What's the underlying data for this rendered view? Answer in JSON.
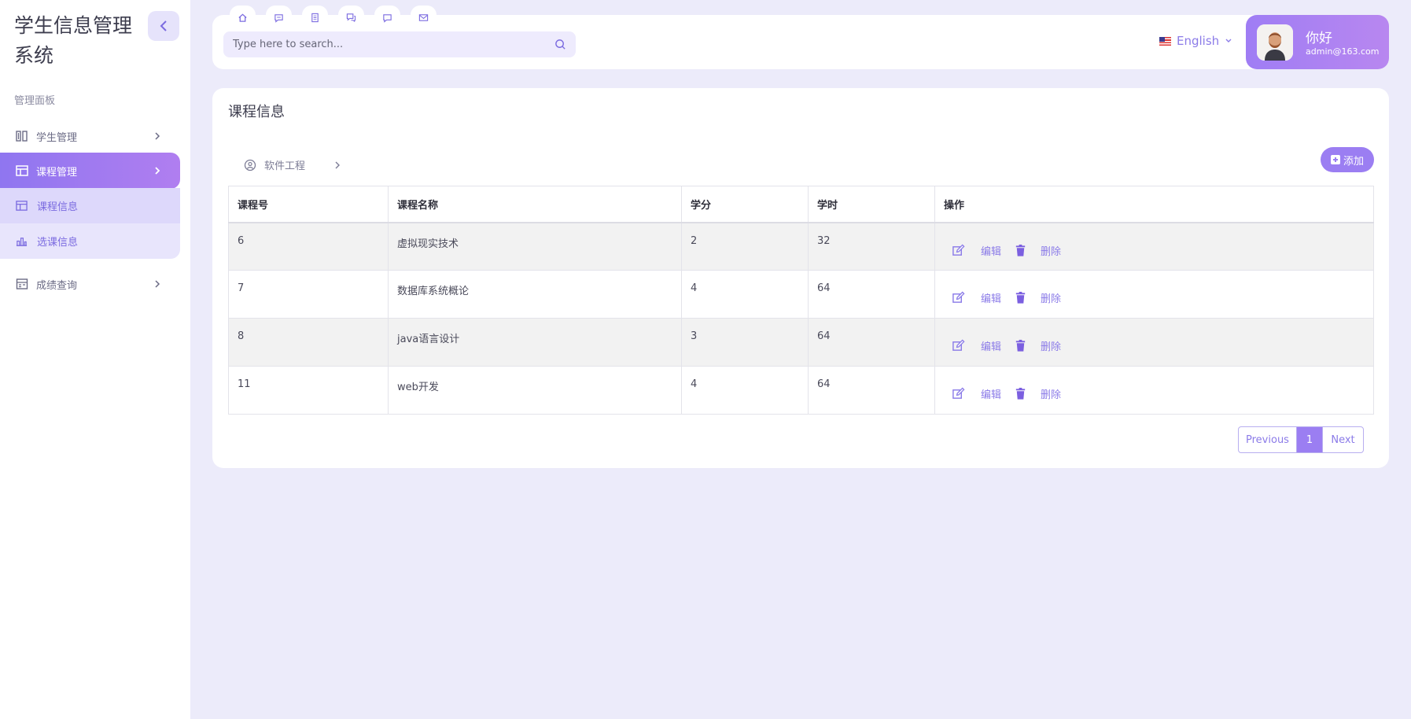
{
  "app": {
    "title": "学生信息管理系统"
  },
  "sidebar": {
    "section_label": "管理面板",
    "items": [
      {
        "label": "学生管理",
        "icon": "columns-icon"
      },
      {
        "label": "课程管理",
        "icon": "table-icon",
        "active": true
      },
      {
        "label": "成绩查询",
        "icon": "calendar-icon"
      }
    ],
    "submenu": [
      {
        "label": "课程信息",
        "icon": "table-icon",
        "current": true
      },
      {
        "label": "选课信息",
        "icon": "chart-icon"
      }
    ]
  },
  "header": {
    "quick_tabs": [
      "home-icon",
      "message-icon",
      "document-icon",
      "chat-icon",
      "comment-icon",
      "mail-icon"
    ],
    "search": {
      "placeholder": "Type here to search..."
    },
    "language": "English",
    "user": {
      "greeting": "你好",
      "email": "admin@163.com"
    }
  },
  "main": {
    "title": "课程信息",
    "breadcrumb": "软件工程",
    "add_label": "添加",
    "table": {
      "columns": [
        "课程号",
        "课程名称",
        "学分",
        "学时",
        "操作"
      ],
      "rows": [
        {
          "id": "6",
          "name": "虚拟现实技术",
          "credit": "2",
          "hours": "32"
        },
        {
          "id": "7",
          "name": "数据库系统概论",
          "credit": "4",
          "hours": "64"
        },
        {
          "id": "8",
          "name": "java语言设计",
          "credit": "3",
          "hours": "64"
        },
        {
          "id": "11",
          "name": "web开发",
          "credit": "4",
          "hours": "64"
        }
      ],
      "edit_label": "编辑",
      "delete_label": "删除"
    },
    "pagination": {
      "prev": "Previous",
      "page": "1",
      "next": "Next"
    }
  },
  "colors": {
    "accent": "#9b7ef2",
    "accent_text": "#8b7be8",
    "background": "#ecebfa"
  }
}
